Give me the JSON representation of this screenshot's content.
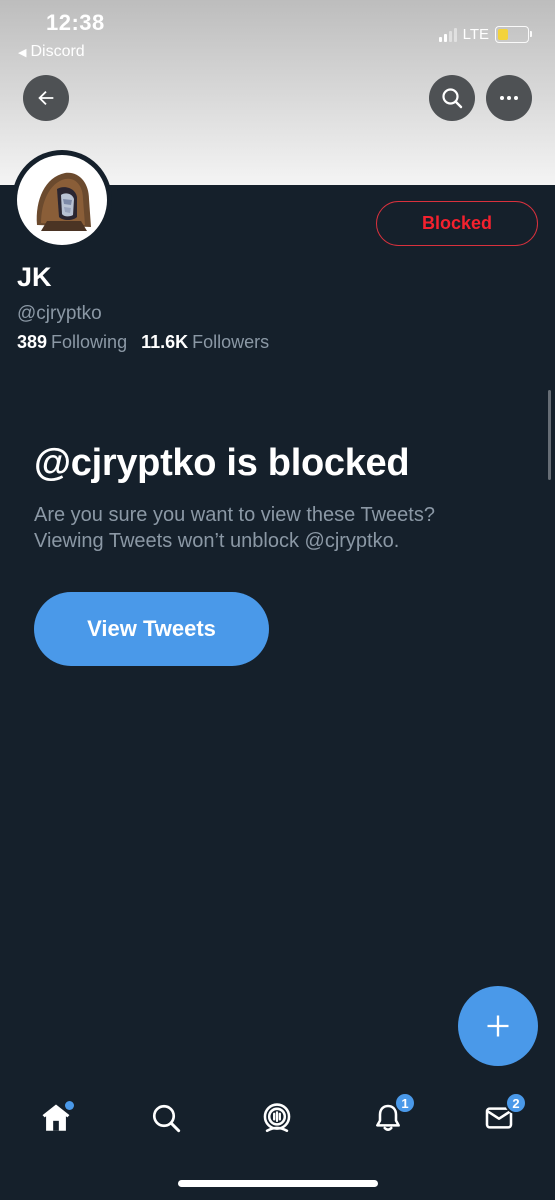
{
  "status_bar": {
    "time": "12:38",
    "back_app": "Discord",
    "network": "LTE",
    "battery_level": 0.35
  },
  "header": {
    "back_icon": "arrow-left-icon",
    "search_icon": "search-icon",
    "more_icon": "more-horizontal-icon"
  },
  "profile": {
    "display_name": "JK",
    "handle": "@cjryptko",
    "following_count": "389",
    "following_label": "Following",
    "followers_count": "11.6K",
    "followers_label": "Followers",
    "blocked_button_label": "Blocked"
  },
  "blocked_notice": {
    "title": "@cjryptko is blocked",
    "description": "Are you sure you want to view these Tweets? Viewing Tweets won’t unblock @cjryptko.",
    "view_button_label": "View Tweets"
  },
  "fab": {
    "icon": "plus-icon"
  },
  "bottom_nav": {
    "items": [
      {
        "name": "home",
        "icon": "home-icon",
        "has_dot": true
      },
      {
        "name": "search",
        "icon": "search-icon"
      },
      {
        "name": "spaces",
        "icon": "spaces-icon"
      },
      {
        "name": "notifications",
        "icon": "bell-icon",
        "badge": "1"
      },
      {
        "name": "messages",
        "icon": "mail-icon",
        "badge": "2"
      }
    ]
  },
  "colors": {
    "background": "#15202b",
    "accent": "#4a99e9",
    "blocked_red": "#f4212e",
    "muted_text": "#8b98a5"
  }
}
